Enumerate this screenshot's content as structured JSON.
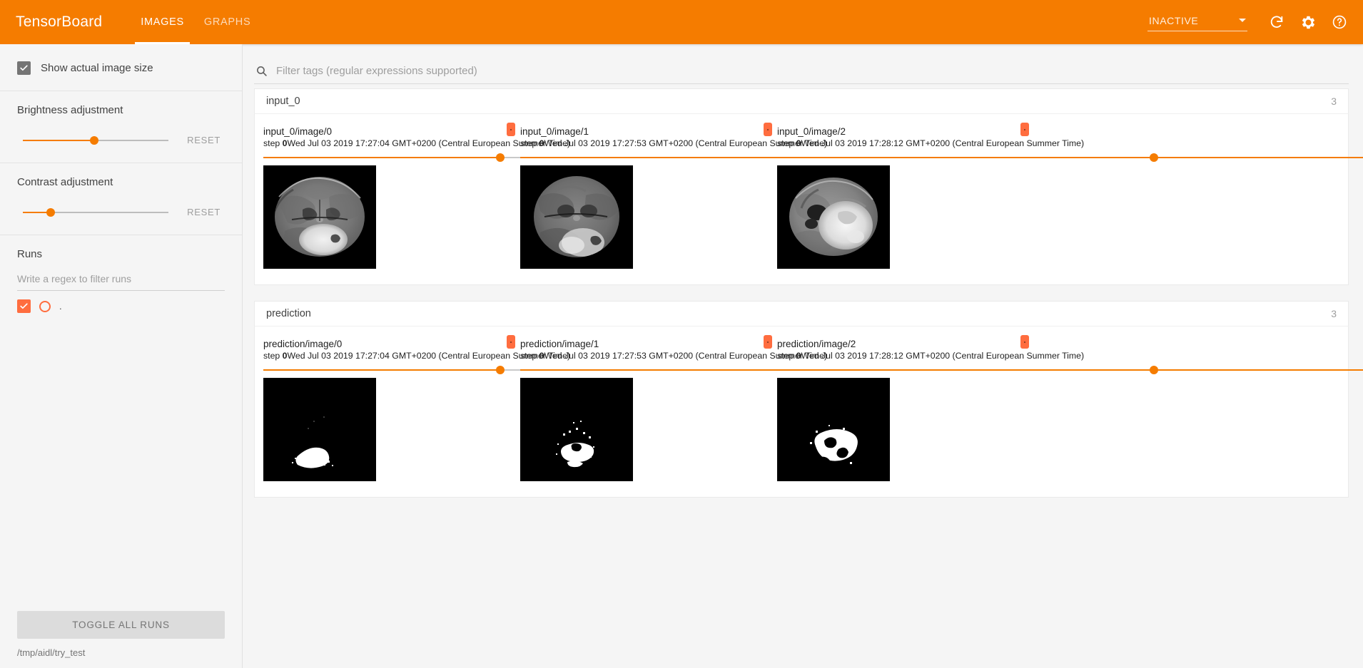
{
  "header": {
    "brand": "TensorBoard",
    "tabs": [
      {
        "label": "IMAGES",
        "active": true
      },
      {
        "label": "GRAPHS",
        "active": false
      }
    ],
    "status": "INACTIVE",
    "icons": [
      "refresh-icon",
      "settings-gear-icon",
      "help-circle-icon"
    ]
  },
  "sidebar": {
    "show_actual_image_size": "Show actual image size",
    "brightness": {
      "label": "Brightness adjustment",
      "reset": "RESET",
      "value_pct": 49
    },
    "contrast": {
      "label": "Contrast adjustment",
      "reset": "RESET",
      "value_pct": 19
    },
    "runs": {
      "title": "Runs",
      "filter_placeholder": "Write a regex to filter runs",
      "filter_value": "",
      "items": [
        {
          "name": ".",
          "checked": true,
          "color": "#ff6d3f"
        }
      ]
    },
    "toggle_all_runs": "TOGGLE ALL RUNS",
    "logdir": "/tmp/aidl/try_test"
  },
  "search": {
    "placeholder": "Filter tags (regular expressions supported)",
    "value": ""
  },
  "sections": [
    {
      "name": "input_0",
      "count": "3",
      "cards": [
        {
          "title": "input_0/image/0",
          "step_label": "step ",
          "step_value": "0",
          "timestamp": "Wed Jul 03 2019 17:27:04 GMT+0200 (Central European Summer Time)",
          "slider_pct": 31,
          "image_kind": "mri-brain-axial"
        },
        {
          "title": "input_0/image/1",
          "step_label": "step ",
          "step_value": "0",
          "timestamp": "Wed Jul 03 2019 17:27:53 GMT+0200 (Central European Summer Time)",
          "slider_pct": 83,
          "image_kind": "mri-brain-axial-2"
        },
        {
          "title": "input_0/image/2",
          "step_label": "step ",
          "step_value": "0",
          "timestamp": "Wed Jul 03 2019 17:28:12 GMT+0200 (Central European Summer Time)",
          "slider_pct": 100,
          "image_kind": "mri-brain-axial-3"
        }
      ]
    },
    {
      "name": "prediction",
      "count": "3",
      "cards": [
        {
          "title": "prediction/image/0",
          "step_label": "step ",
          "step_value": "0",
          "timestamp": "Wed Jul 03 2019 17:27:04 GMT+0200 (Central European Summer Time)",
          "slider_pct": 31,
          "image_kind": "mask-1"
        },
        {
          "title": "prediction/image/1",
          "step_label": "step ",
          "step_value": "0",
          "timestamp": "Wed Jul 03 2019 17:27:53 GMT+0200 (Central European Summer Time)",
          "slider_pct": 83,
          "image_kind": "mask-2"
        },
        {
          "title": "prediction/image/2",
          "step_label": "step ",
          "step_value": "0",
          "timestamp": "Wed Jul 03 2019 17:28:12 GMT+0200 (Central European Summer Time)",
          "slider_pct": 100,
          "image_kind": "mask-3"
        }
      ]
    }
  ],
  "colors": {
    "brand_orange": "#f57c00",
    "accent_orange": "#ff6d3f",
    "sidebar_bg": "#f5f5f5"
  }
}
